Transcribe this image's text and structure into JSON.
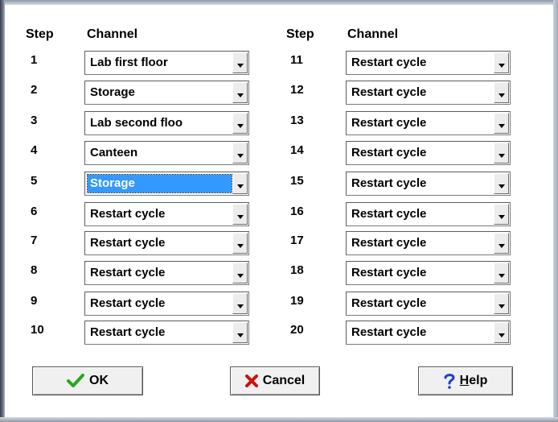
{
  "headers": {
    "step_left": "Step",
    "channel_left": "Channel",
    "step_right": "Step",
    "channel_right": "Channel"
  },
  "steps": [
    {
      "step": "1",
      "channel": "Lab first floor",
      "selected": false
    },
    {
      "step": "2",
      "channel": "Storage",
      "selected": false
    },
    {
      "step": "3",
      "channel": "Lab second floo",
      "selected": false
    },
    {
      "step": "4",
      "channel": "Canteen",
      "selected": false
    },
    {
      "step": "5",
      "channel": "Storage",
      "selected": true
    },
    {
      "step": "6",
      "channel": "Restart cycle",
      "selected": false
    },
    {
      "step": "7",
      "channel": "Restart cycle",
      "selected": false
    },
    {
      "step": "8",
      "channel": "Restart cycle",
      "selected": false
    },
    {
      "step": "9",
      "channel": "Restart cycle",
      "selected": false
    },
    {
      "step": "10",
      "channel": "Restart cycle",
      "selected": false
    },
    {
      "step": "11",
      "channel": "Restart cycle",
      "selected": false
    },
    {
      "step": "12",
      "channel": "Restart cycle",
      "selected": false
    },
    {
      "step": "13",
      "channel": "Restart cycle",
      "selected": false
    },
    {
      "step": "14",
      "channel": "Restart cycle",
      "selected": false
    },
    {
      "step": "15",
      "channel": "Restart cycle",
      "selected": false
    },
    {
      "step": "16",
      "channel": "Restart cycle",
      "selected": false
    },
    {
      "step": "17",
      "channel": "Restart cycle",
      "selected": false
    },
    {
      "step": "18",
      "channel": "Restart cycle",
      "selected": false
    },
    {
      "step": "19",
      "channel": "Restart cycle",
      "selected": false
    },
    {
      "step": "20",
      "channel": "Restart cycle",
      "selected": false
    }
  ],
  "buttons": {
    "ok": {
      "label": "OK",
      "icon": "checkmark-icon",
      "color": "#22aa22"
    },
    "cancel": {
      "label": "Cancel",
      "icon": "x-icon",
      "color": "#cc1111"
    },
    "help": {
      "label_mnemonic": "H",
      "label_rest": "elp",
      "icon": "question-mark-icon",
      "color": "#1a3fcf"
    }
  },
  "colors": {
    "selection": "#3399ff"
  }
}
